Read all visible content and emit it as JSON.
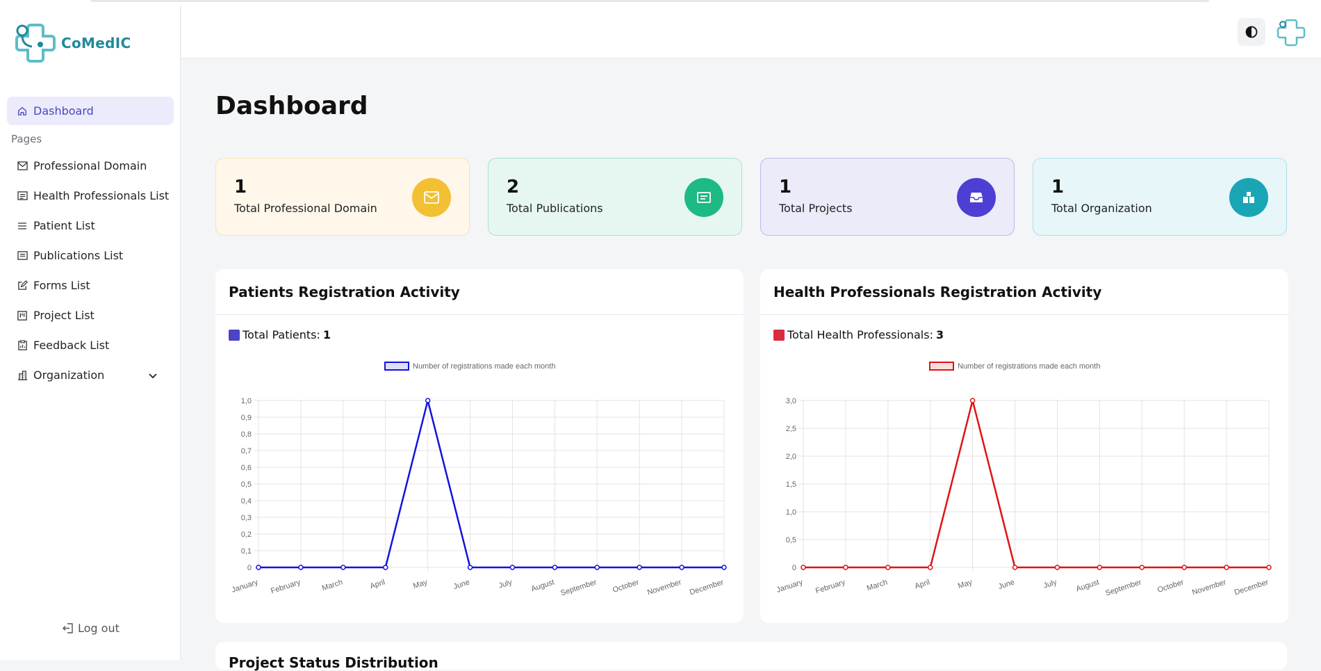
{
  "brand": {
    "name": "CoMedIC"
  },
  "sidebar": {
    "items": [
      {
        "label": "Dashboard",
        "icon": "home-icon",
        "active": true
      },
      {
        "section": "Pages"
      },
      {
        "label": "Professional Domain",
        "icon": "mail-icon"
      },
      {
        "label": "Health Professionals List",
        "icon": "list-icon"
      },
      {
        "label": "Patient List",
        "icon": "menu-icon"
      },
      {
        "label": "Publications List",
        "icon": "news-icon"
      },
      {
        "label": "Forms List",
        "icon": "edit-icon"
      },
      {
        "label": "Project List",
        "icon": "kanban-icon"
      },
      {
        "label": "Feedback List",
        "icon": "clipboard-icon"
      },
      {
        "label": "Organization",
        "icon": "building-icon",
        "expandable": true
      }
    ],
    "logout_label": "Log out"
  },
  "page": {
    "title": "Dashboard"
  },
  "stats": [
    {
      "value": "1",
      "label": "Total Professional Domain",
      "color": "#f3c033",
      "bg": "#fef7ea",
      "border": "#f8e2b8",
      "icon": "mail-icon"
    },
    {
      "value": "2",
      "label": "Total Publications",
      "color": "#1dba84",
      "bg": "#e6f7f1",
      "border": "#a9e2cd",
      "icon": "news-icon"
    },
    {
      "value": "1",
      "label": "Total Projects",
      "color": "#4d3fd3",
      "bg": "#ecebfa",
      "border": "#bdb9ec",
      "icon": "inbox-icon"
    },
    {
      "value": "1",
      "label": "Total Organization",
      "color": "#1aa5b5",
      "bg": "#e6f6f9",
      "border": "#a9e0e8",
      "icon": "blocks-icon"
    }
  ],
  "charts": [
    {
      "title": "Patients Registration Activity",
      "total_label": "Total Patients:",
      "total_value": "1",
      "swatch": "#4a44c6"
    },
    {
      "title": "Health Professionals Registration Activity",
      "total_label": "Total Health Professionals:",
      "total_value": "3",
      "swatch": "#d92c3f"
    }
  ],
  "chart_data": [
    {
      "type": "line",
      "categories": [
        "January",
        "February",
        "March",
        "April",
        "May",
        "June",
        "July",
        "August",
        "September",
        "October",
        "November",
        "December"
      ],
      "series": [
        {
          "name": "Number of registrations made each month",
          "values": [
            0,
            0,
            0,
            0,
            1,
            0,
            0,
            0,
            0,
            0,
            0,
            0
          ]
        }
      ],
      "ylim": [
        0,
        1
      ],
      "yticks": [
        "0",
        "0,1",
        "0,2",
        "0,3",
        "0,4",
        "0,5",
        "0,6",
        "0,7",
        "0,8",
        "0,9",
        "1,0"
      ],
      "color": "#1212e0",
      "grid": true,
      "legend": "top"
    },
    {
      "type": "line",
      "categories": [
        "January",
        "February",
        "March",
        "April",
        "May",
        "June",
        "July",
        "August",
        "September",
        "October",
        "November",
        "December"
      ],
      "series": [
        {
          "name": "Number of registrations made each month",
          "values": [
            0,
            0,
            0,
            0,
            3,
            0,
            0,
            0,
            0,
            0,
            0,
            0
          ]
        }
      ],
      "ylim": [
        0,
        3
      ],
      "yticks": [
        "0",
        "0,5",
        "1,0",
        "1,5",
        "2,0",
        "2,5",
        "3,0"
      ],
      "color": "#e01212",
      "grid": true,
      "legend": "top"
    }
  ],
  "bottom_section": {
    "title": "Project Status Distribution"
  }
}
